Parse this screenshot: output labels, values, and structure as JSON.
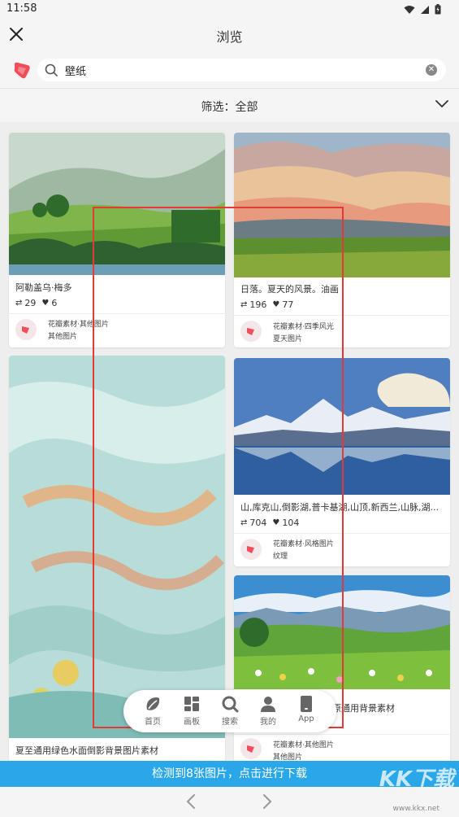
{
  "status_bar": {
    "time": "11:58"
  },
  "app_bar": {
    "title": "浏览",
    "close_icon": "close-icon"
  },
  "search": {
    "value": "壁纸",
    "clear_icon": "clear-icon"
  },
  "filter": {
    "label": "筛选：全部"
  },
  "colors": {
    "accent_red": "#ef4e5a",
    "banner_blue": "#2aa7e8",
    "highlight_box": "#e53935"
  },
  "cards": [
    {
      "title": "阿勒盖乌·梅多",
      "repins": "29",
      "likes": "6",
      "source_line1": "花瓣素材·其他图片",
      "source_line2": "其他图片"
    },
    {
      "title": "日落。夏天的风景。油画",
      "repins": "196",
      "likes": "77",
      "source_line1": "花瓣素材·四季风光",
      "source_line2": "夏天图片"
    },
    {
      "title": "夏至通用绿色水面倒影背景图片素材"
    },
    {
      "title": "山,库克山,倒影湖,普卡基湖,山顶,新西兰,山脉,湖...",
      "repins": "704",
      "likes": "104",
      "source_line1": "花瓣素材·风格图片",
      "source_line2": "纹理"
    },
    {
      "title": "草原通用背景素材",
      "source_line1": "花瓣素材·其他图片",
      "source_line2": "其他图片"
    }
  ],
  "tabs": [
    {
      "label": "首页",
      "icon": "home-icon"
    },
    {
      "label": "画板",
      "icon": "boards-icon"
    },
    {
      "label": "搜索",
      "icon": "search-icon"
    },
    {
      "label": "我的",
      "icon": "profile-icon"
    },
    {
      "label": "App",
      "icon": "app-icon"
    }
  ],
  "banner": {
    "text": "检测到8张图片，点击进行下载"
  },
  "watermark": {
    "brand": "KK下载",
    "url": "www.kkx.net"
  }
}
